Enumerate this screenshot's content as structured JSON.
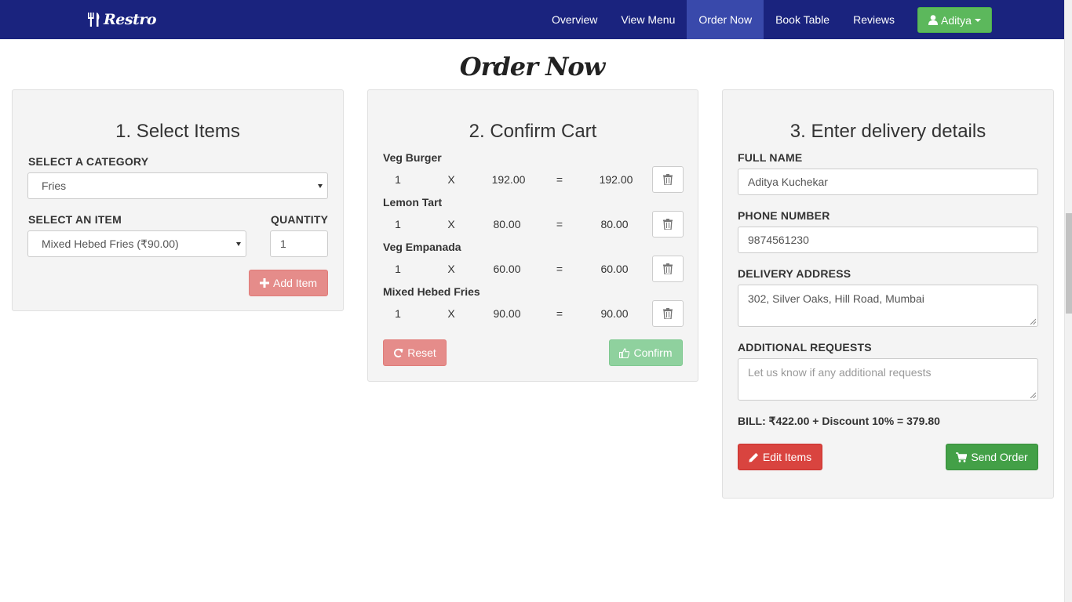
{
  "brand": {
    "name": "Restro"
  },
  "nav": {
    "items": [
      {
        "label": "Overview"
      },
      {
        "label": "View Menu"
      },
      {
        "label": "Order Now"
      },
      {
        "label": "Book Table"
      },
      {
        "label": "Reviews"
      }
    ],
    "active": "Order Now",
    "user": "Aditya"
  },
  "page_title": "Order Now",
  "select_items": {
    "heading": "1. Select Items",
    "category_label": "SELECT A CATEGORY",
    "category_value": "Fries",
    "item_label": "SELECT AN ITEM",
    "item_value": "Mixed Hebed Fries (₹90.00)",
    "quantity_label": "QUANTITY",
    "quantity_value": "1",
    "add_button": "Add Item"
  },
  "cart": {
    "heading": "2. Confirm Cart",
    "items": [
      {
        "name": "Veg Burger",
        "qty": "1",
        "x": "X",
        "price": "192.00",
        "eq": "=",
        "total": "192.00"
      },
      {
        "name": "Lemon Tart",
        "qty": "1",
        "x": "X",
        "price": "80.00",
        "eq": "=",
        "total": "80.00"
      },
      {
        "name": "Veg Empanada",
        "qty": "1",
        "x": "X",
        "price": "60.00",
        "eq": "=",
        "total": "60.00"
      },
      {
        "name": "Mixed Hebed Fries",
        "qty": "1",
        "x": "X",
        "price": "90.00",
        "eq": "=",
        "total": "90.00"
      }
    ],
    "reset_button": "Reset",
    "confirm_button": "Confirm"
  },
  "delivery": {
    "heading": "3. Enter delivery details",
    "name_label": "FULL NAME",
    "name_value": "Aditya Kuchekar",
    "phone_label": "PHONE NUMBER",
    "phone_value": "9874561230",
    "address_label": "DELIVERY ADDRESS",
    "address_value": "302, Silver Oaks, Hill Road, Mumbai",
    "requests_label": "ADDITIONAL REQUESTS",
    "requests_placeholder": "Let us know if any additional requests",
    "bill": "BILL: ₹422.00 + Discount 10% = 379.80",
    "edit_button": "Edit Items",
    "send_button": "Send Order"
  },
  "colors": {
    "navbar": "#1a237e",
    "nav_active": "#3949ab",
    "user_button": "#5cb85c",
    "panel_bg": "#f4f4f4",
    "danger": "#d9443f",
    "success": "#43a047"
  },
  "icons": {
    "brand": "utensils-icon",
    "user": "user-icon",
    "add": "plus-icon",
    "trash": "trash-icon",
    "reset": "refresh-icon",
    "confirm": "thumbs-up-icon",
    "edit": "pencil-icon",
    "send": "cart-icon"
  }
}
